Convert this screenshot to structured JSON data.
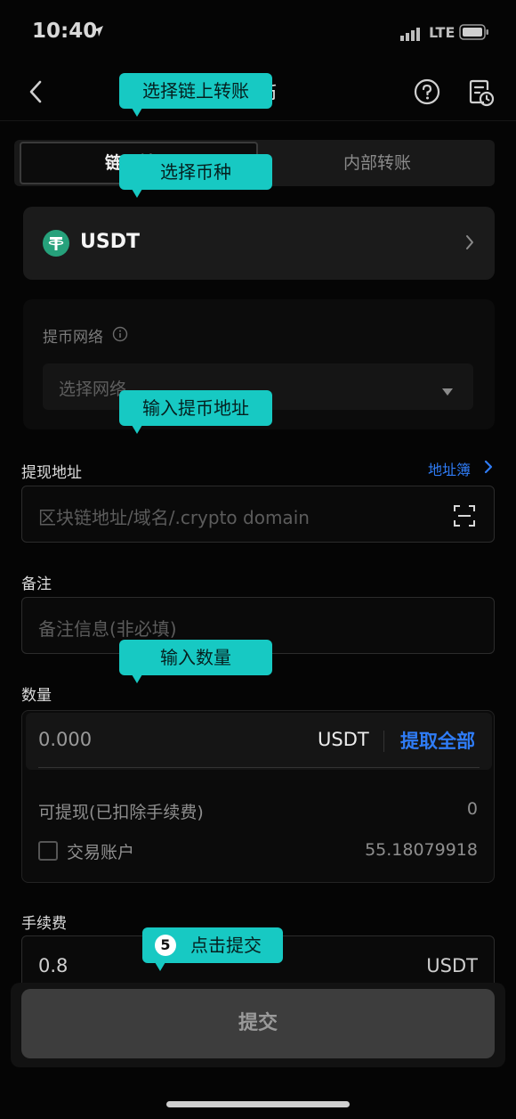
{
  "status_bar": {
    "time": "10:40",
    "network": "LTE"
  },
  "navbar": {
    "title": "提币"
  },
  "tabs": [
    {
      "label": "链上转账",
      "active": true
    },
    {
      "label": "内部转账",
      "active": false
    }
  ],
  "coin": {
    "name": "USDT",
    "logo_color": "#26a17b"
  },
  "network": {
    "label": "提币网络",
    "placeholder": "选择网络"
  },
  "address": {
    "label": "提现地址",
    "book_label": "地址簿",
    "placeholder": "区块链地址/域名/.crypto domain"
  },
  "memo": {
    "label": "备注",
    "placeholder": "备注信息(非必填)"
  },
  "amount": {
    "label": "数量",
    "value": "0.000",
    "unit": "USDT",
    "max_label": "提取全部",
    "available_label": "可提现(已扣除手续费)",
    "available_value": "0",
    "trade_account_label": "交易账户",
    "trade_account_value": "55.18079918",
    "trade_account_checked": false
  },
  "fee": {
    "label": "手续费",
    "value": "0.8",
    "unit": "USDT"
  },
  "submit": {
    "label": "提交"
  },
  "tooltips": {
    "tip1": "选择链上转账",
    "tip2": "选择币种",
    "tip3": "输入提币地址",
    "tip4": "输入数量",
    "tip5_number": "5",
    "tip5": "点击提交"
  },
  "colors": {
    "accent": "#2f7cf6",
    "tooltip": "#17c9c3",
    "background": "#050505"
  }
}
